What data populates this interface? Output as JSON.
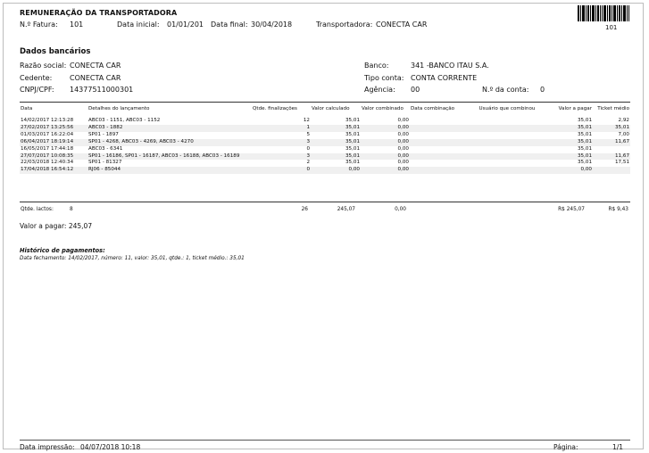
{
  "header": {
    "title": "REMUNERAÇÃO DA TRANSPORTADORA",
    "fatura_label": "N.º Fatura:",
    "fatura_value": "101",
    "data_inicial_label": "Data inicial:",
    "data_inicial_value": "01/01/201",
    "data_final_label": "Data final:",
    "data_final_value": "30/04/2018",
    "transportadora_label": "Transportadora:",
    "transportadora_value": "CONECTA CAR",
    "barcode_number": "101"
  },
  "bank": {
    "section_title": "Dados bancários",
    "razao_label": "Razão social:",
    "razao_value": "CONECTA CAR",
    "cedente_label": "Cedente:",
    "cedente_value": "CONECTA CAR",
    "cnpj_label": "CNPJ/CPF:",
    "cnpj_value": "14377511000301",
    "banco_label": "Banco:",
    "banco_value": "341 -BANCO ITAU S.A.",
    "tipo_label": "Tipo conta:",
    "tipo_value": "CONTA CORRENTE",
    "agencia_label": "Agência:",
    "agencia_value": "00",
    "conta_label": "N.º da conta:",
    "conta_value": "0"
  },
  "table": {
    "columns": [
      "Data",
      "Detalhes do lançamento",
      "Qtde. finalizações",
      "Valor calculado",
      "Valor combinado",
      "Data combinação",
      "Usuário que combinou",
      "Valor a pagar",
      "Ticket médio"
    ],
    "rows": [
      {
        "data": "14/02/2017 12:13:28",
        "detalhes": "ABC03 - 1151, ABC03 - 1152",
        "qtde": "12",
        "calc": "35,01",
        "comb": "0,00",
        "data_comb": "",
        "usuario": "",
        "pagar": "35,01",
        "ticket": "2,92"
      },
      {
        "data": "27/02/2017 13:25:56",
        "detalhes": "ABC03 - 1882",
        "qtde": "1",
        "calc": "35,01",
        "comb": "0,00",
        "data_comb": "",
        "usuario": "",
        "pagar": "35,01",
        "ticket": "35,01"
      },
      {
        "data": "01/03/2017 16:22:04",
        "detalhes": "SP01 - 1897",
        "qtde": "5",
        "calc": "35,01",
        "comb": "0,00",
        "data_comb": "",
        "usuario": "",
        "pagar": "35,01",
        "ticket": "7,00"
      },
      {
        "data": "06/04/2017 18:19:14",
        "detalhes": "SP01 - 4268, ABC03 - 4269, ABC03 - 4270",
        "qtde": "3",
        "calc": "35,01",
        "comb": "0,00",
        "data_comb": "",
        "usuario": "",
        "pagar": "35,01",
        "ticket": "11,67"
      },
      {
        "data": "16/05/2017 17:44:18",
        "detalhes": "ABC03 - 6341",
        "qtde": "0",
        "calc": "35,01",
        "comb": "0,00",
        "data_comb": "",
        "usuario": "",
        "pagar": "35,01",
        "ticket": ""
      },
      {
        "data": "27/07/2017 10:08:35",
        "detalhes": "SP01 - 16186, SP01 - 16187, ABC03 - 16188, ABC03 - 16189",
        "qtde": "3",
        "calc": "35,01",
        "comb": "0,00",
        "data_comb": "",
        "usuario": "",
        "pagar": "35,01",
        "ticket": "11,67"
      },
      {
        "data": "22/03/2018 12:40:34",
        "detalhes": "SP01 - 81327",
        "qtde": "2",
        "calc": "35,01",
        "comb": "0,00",
        "data_comb": "",
        "usuario": "",
        "pagar": "35,01",
        "ticket": "17,51"
      },
      {
        "data": "17/04/2018 16:54:12",
        "detalhes": "RJ06 - 85044",
        "qtde": "0",
        "calc": "0,00",
        "comb": "0,00",
        "data_comb": "",
        "usuario": "",
        "pagar": "0,00",
        "ticket": ""
      }
    ],
    "totals": {
      "label": "Qtde. lactos:",
      "count": "8",
      "qtde": "26",
      "calc": "245,07",
      "comb": "0,00",
      "pagar": "R$ 245,07",
      "ticket": "R$ 9,43"
    }
  },
  "summary": {
    "valor_label": "Valor a pagar:",
    "valor_value": "245,07"
  },
  "history": {
    "title": "Histórico de pagamentos:",
    "line": "Data fechamento: 14/02/2017, número: 11, valor: 35,01, qtde.: 1, ticket médio.: 35,01"
  },
  "footer": {
    "impressao_label": "Data impressão:",
    "impressao_value": "04/07/2018 10:18",
    "pagina_label": "Página:",
    "pagina_value": "1/1"
  }
}
